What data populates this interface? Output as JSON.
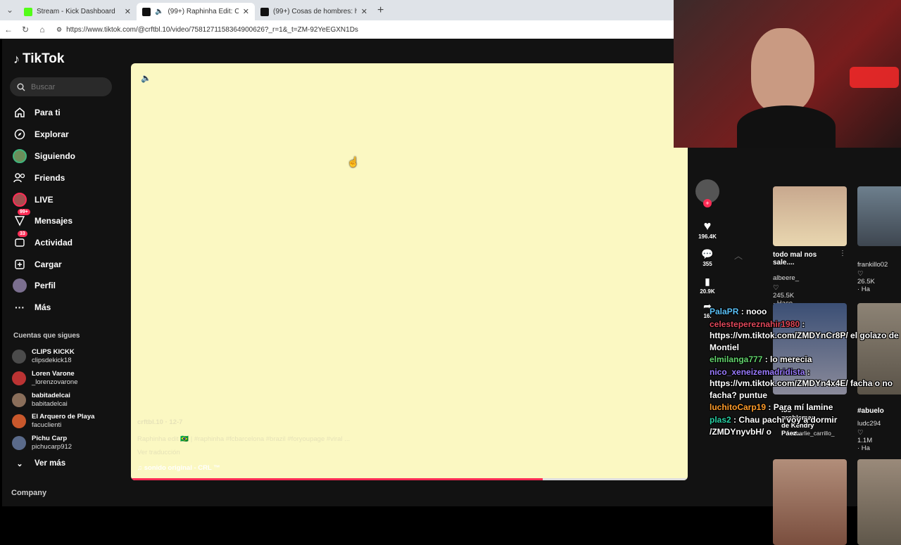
{
  "browser": {
    "tabs": [
      {
        "title": "Stream - Kick Dashboard",
        "active": false
      },
      {
        "title": "(99+) Raphinha Edit: Celebratin",
        "active": true
      },
      {
        "title": "(99+) Cosas de hombres: humor y",
        "active": false
      }
    ],
    "url": "https://www.tiktok.com/@crftbl.10/video/7581271158364900626?_r=1&_t=ZM-92YeEGXN1Ds"
  },
  "sidebar": {
    "logo": "TikTok",
    "search_placeholder": "Buscar",
    "nav": [
      {
        "label": "Para ti",
        "icon": "home-icon"
      },
      {
        "label": "Explorar",
        "icon": "compass-icon"
      },
      {
        "label": "Siguiendo",
        "icon": "following-avatar-icon"
      },
      {
        "label": "Friends",
        "icon": "friends-icon"
      },
      {
        "label": "LIVE",
        "icon": "live-avatar-icon"
      },
      {
        "label": "Mensajes",
        "icon": "messages-icon",
        "badge": "99+"
      },
      {
        "label": "Actividad",
        "icon": "activity-icon",
        "badge": "33"
      },
      {
        "label": "Cargar",
        "icon": "upload-icon"
      },
      {
        "label": "Perfil",
        "icon": "profile-avatar-icon"
      },
      {
        "label": "Más",
        "icon": "more-icon"
      }
    ],
    "following_title": "Cuentas que sigues",
    "following": [
      {
        "name": "CLIPS KICKK",
        "user": "clipsdekick18"
      },
      {
        "name": "Loren Varone",
        "user": "_lorenzovarone"
      },
      {
        "name": "babitadelcai",
        "user": "babitadelcai"
      },
      {
        "name": "El Arquero de Playa",
        "user": "facuclienti"
      },
      {
        "name": "Pichu Carp",
        "user": "pichucarp912"
      }
    ],
    "see_more": "Ver más",
    "company": "Company"
  },
  "video": {
    "author": "crftbl.10",
    "date": "12-7",
    "caption": "Raphinha edit 🇧🇷 | #raphinha #fcbarcelona #brazil #foryoupage #viral ...",
    "translate": "Ver traducción",
    "sound": "sonido original - CRL ™",
    "progress": 0.74
  },
  "rail": {
    "likes": "196.4K",
    "comments": "355",
    "saves": "20.9K",
    "shares": "16."
  },
  "thumbs": [
    {
      "caption": "todo mal nos sale....",
      "user": "albeere_",
      "stats": "245.5K · Hace 2 d"
    },
    {
      "caption": "",
      "user": "frankillo02",
      "stats": "26.5K · Ha"
    },
    {
      "caption": "los problemas de Kendry Páez...",
      "user": "charlie_carrillo_",
      "stats": ""
    },
    {
      "caption": "#abuelo",
      "user": "ludc294",
      "stats": "1.1M · Ha"
    }
  ],
  "chat": [
    {
      "user": "PalaPR",
      "msg": "nooo",
      "color": "#5bc0f5"
    },
    {
      "user": "celestepereznahir1980",
      "msg": "https://vm.tiktok.com/ZMDYnCr8P/ el golazo de Montiel",
      "color": "#e0485a"
    },
    {
      "user": "elmilanga777",
      "msg": "lo merecia",
      "color": "#62d36c"
    },
    {
      "user": "nico_xeneizemadridista",
      "msg": "https://vm.tiktok.com/ZMDYn4x4E/ facha o no facha? puntue",
      "color": "#9a7bff"
    },
    {
      "user": "luchitoCarp19",
      "msg": "Para mí lamine",
      "color": "#ff9c2a"
    },
    {
      "user": "plas2",
      "msg": "Chau pachi voy a dormir",
      "color": "#29d1a4"
    },
    {
      "user": "",
      "msg": "/ZMDYnyvbH/ o",
      "color": "#ffffff"
    }
  ]
}
